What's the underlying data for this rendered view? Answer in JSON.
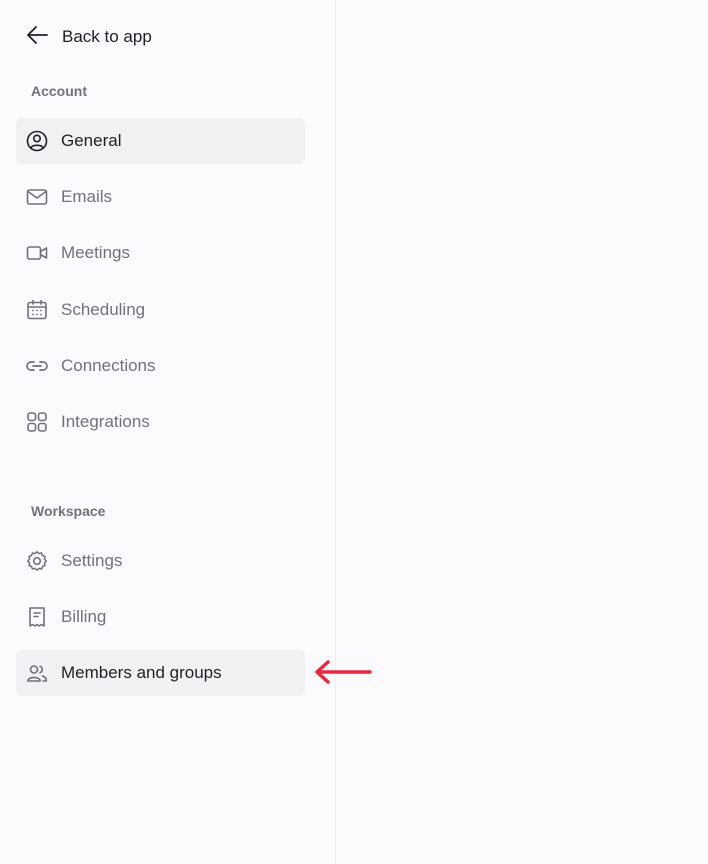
{
  "sidebar": {
    "back_label": "Back to app",
    "sections": [
      {
        "title": "Account",
        "items": [
          {
            "label": "General",
            "icon": "user-circle-icon",
            "active": true
          },
          {
            "label": "Emails",
            "icon": "mail-icon"
          },
          {
            "label": "Meetings",
            "icon": "video-camera-icon"
          },
          {
            "label": "Scheduling",
            "icon": "calendar-icon"
          },
          {
            "label": "Connections",
            "icon": "link-icon"
          },
          {
            "label": "Integrations",
            "icon": "grid-icon"
          }
        ]
      },
      {
        "title": "Workspace",
        "items": [
          {
            "label": "Settings",
            "icon": "gear-icon"
          },
          {
            "label": "Billing",
            "icon": "receipt-icon"
          },
          {
            "label": "Members and groups",
            "icon": "users-icon",
            "highlighted": true
          }
        ]
      }
    ]
  },
  "colors": {
    "active_bg": "#f1f1f3",
    "text_primary": "#1f2023",
    "text_secondary": "#6f727b",
    "annotation_arrow": "#e8283f"
  }
}
